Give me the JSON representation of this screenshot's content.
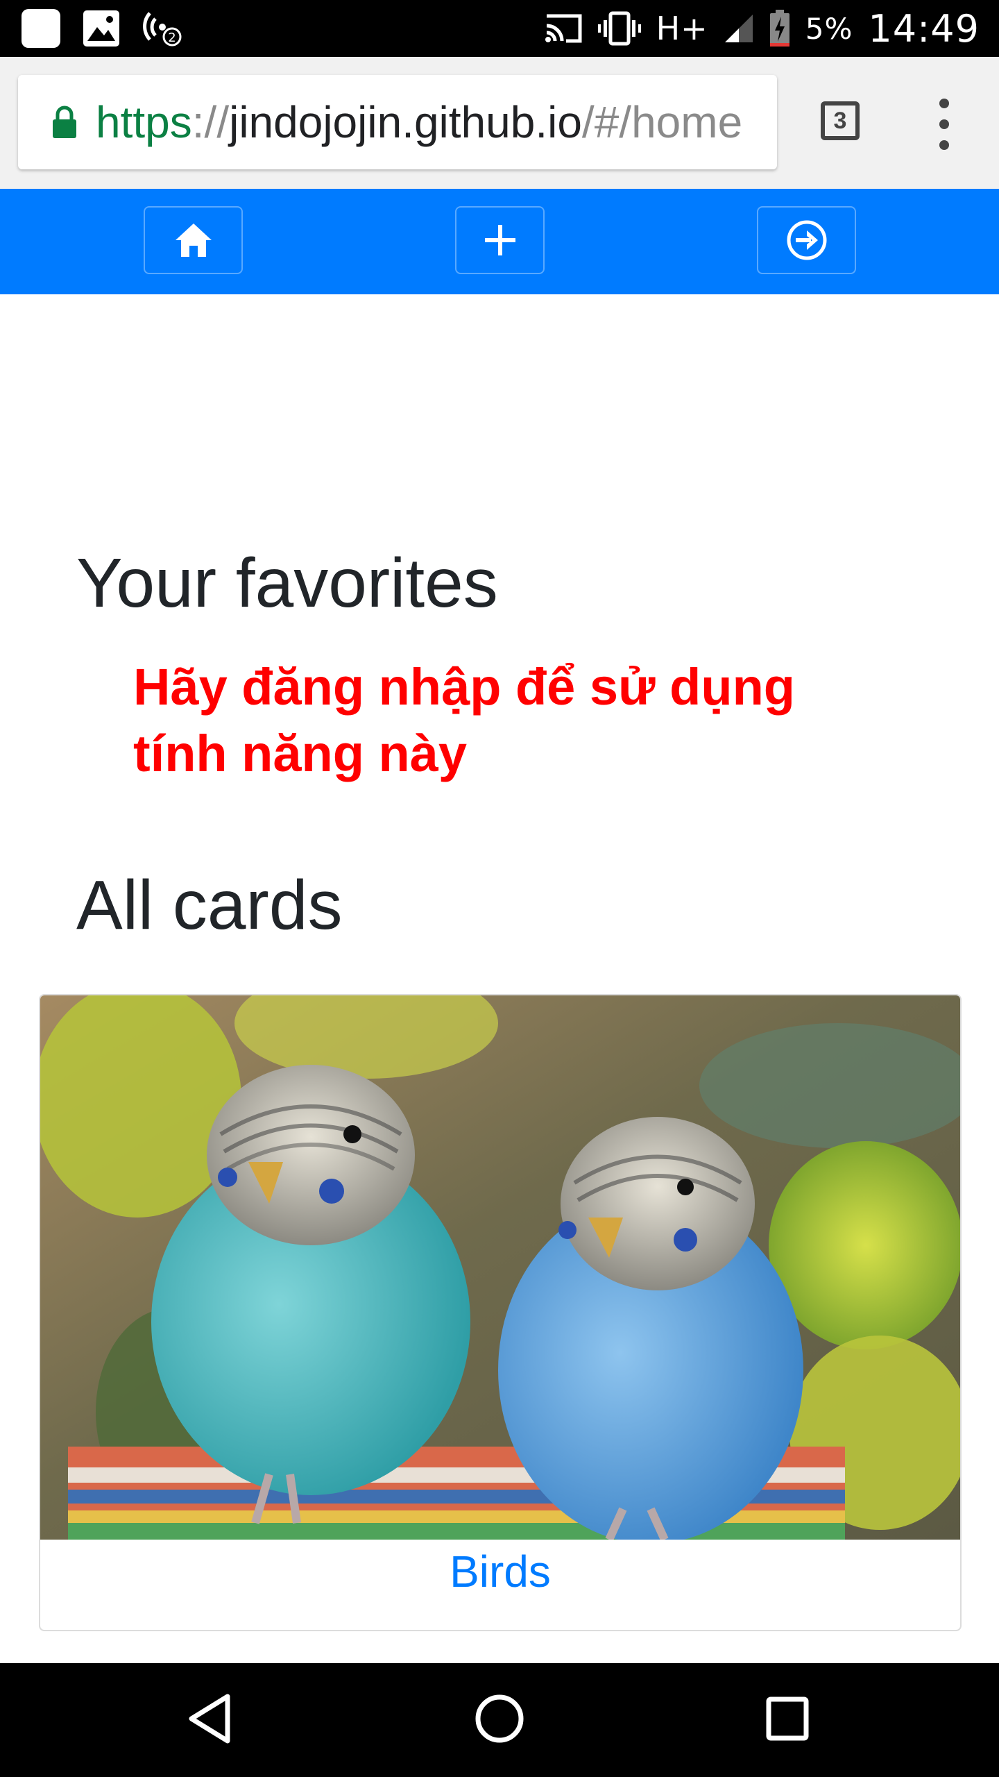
{
  "status_bar": {
    "battery_percent": "5%",
    "time": "14:49",
    "network": "H+"
  },
  "browser": {
    "url_scheme": "https",
    "url_separator": "://",
    "url_host": "jindojojin.github.io",
    "url_path": "/#/home",
    "tab_count": "3"
  },
  "app_nav": {
    "buttons": [
      {
        "icon": "home-icon"
      },
      {
        "icon": "plus-icon"
      },
      {
        "icon": "sign-in-icon"
      }
    ],
    "background_color": "#007bff"
  },
  "main": {
    "favorites_heading": "Your favorites",
    "login_warning": "Hãy đăng nhập để sử dụng tính năng này",
    "all_cards_heading": "All cards",
    "cards": [
      {
        "title": "Birds"
      }
    ]
  },
  "colors": {
    "warning": "#ff0000",
    "link": "#007bff",
    "secure_url": "#0b8043"
  }
}
